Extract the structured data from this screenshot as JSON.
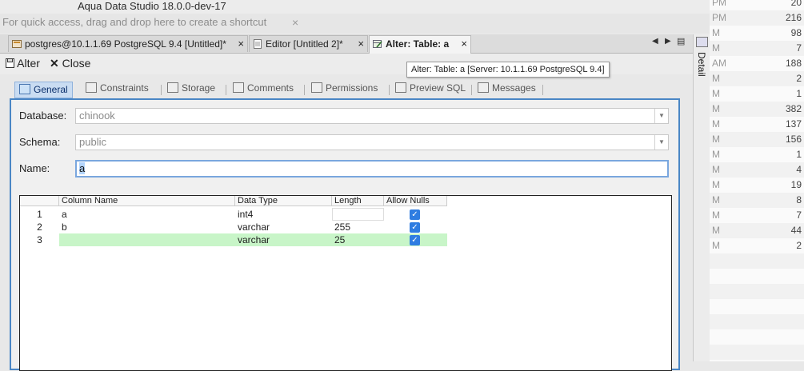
{
  "window": {
    "title": "Aqua Data Studio 18.0.0-dev-17"
  },
  "shortcut_bar": {
    "hint": "For quick access, drag and drop here to create a shortcut",
    "close_glyph": "×"
  },
  "tabs": [
    {
      "label": "postgres@10.1.1.69 PostgreSQL 9.4 [Untitled]*",
      "icon": "connection-icon",
      "close": "×"
    },
    {
      "label": "Editor [Untitled 2]*",
      "icon": "document-icon",
      "close": "×"
    },
    {
      "label": "Alter: Table: a",
      "icon": "alter-table-icon",
      "close": "×",
      "active": true
    }
  ],
  "tab_nav": {
    "prev": "◀",
    "next": "▶",
    "menu": "▤"
  },
  "tooltip": "Alter: Table: a [Server: 10.1.1.69 PostgreSQL 9.4]",
  "toolbar": {
    "alter_label": "Alter",
    "close_label": "Close"
  },
  "subtabs": [
    {
      "label": "General",
      "active": true
    },
    {
      "label": "Constraints"
    },
    {
      "label": "Storage"
    },
    {
      "label": "Comments"
    },
    {
      "label": "Permissions"
    },
    {
      "label": "Preview SQL"
    },
    {
      "label": "Messages"
    }
  ],
  "form": {
    "database_label": "Database:",
    "database_value": "chinook",
    "schema_label": "Schema:",
    "schema_value": "public",
    "name_label": "Name:",
    "name_value": "a"
  },
  "grid": {
    "headers": [
      "Column Name",
      "Data Type",
      "Length",
      "Allow Nulls"
    ],
    "rows": [
      {
        "num": "1",
        "name": "a",
        "type": "int4",
        "length": "",
        "nulls": true
      },
      {
        "num": "2",
        "name": "b",
        "type": "varchar",
        "length": "255",
        "nulls": true
      },
      {
        "num": "3",
        "name": "",
        "type": "varchar",
        "length": "25",
        "nulls": true,
        "new": true
      }
    ]
  },
  "side_strip": {
    "label": "Detail"
  },
  "right_list": [
    {
      "a": "PM",
      "v": "20"
    },
    {
      "a": "PM",
      "v": "216"
    },
    {
      "a": "M",
      "v": "98"
    },
    {
      "a": "M",
      "v": "7"
    },
    {
      "a": "AM",
      "v": "188"
    },
    {
      "a": "M",
      "v": "2"
    },
    {
      "a": "M",
      "v": "1"
    },
    {
      "a": "M",
      "v": "382"
    },
    {
      "a": "M",
      "v": "137"
    },
    {
      "a": "M",
      "v": "156"
    },
    {
      "a": "M",
      "v": "1"
    },
    {
      "a": "M",
      "v": "4"
    },
    {
      "a": "M",
      "v": "19"
    },
    {
      "a": "M",
      "v": "8"
    },
    {
      "a": "M",
      "v": "7"
    },
    {
      "a": "M",
      "v": "44"
    },
    {
      "a": "M",
      "v": "2"
    },
    {
      "a": "",
      "v": ""
    },
    {
      "a": "",
      "v": ""
    },
    {
      "a": "",
      "v": ""
    },
    {
      "a": "",
      "v": ""
    },
    {
      "a": "",
      "v": ""
    },
    {
      "a": "",
      "v": ""
    },
    {
      "a": "",
      "v": ""
    }
  ]
}
